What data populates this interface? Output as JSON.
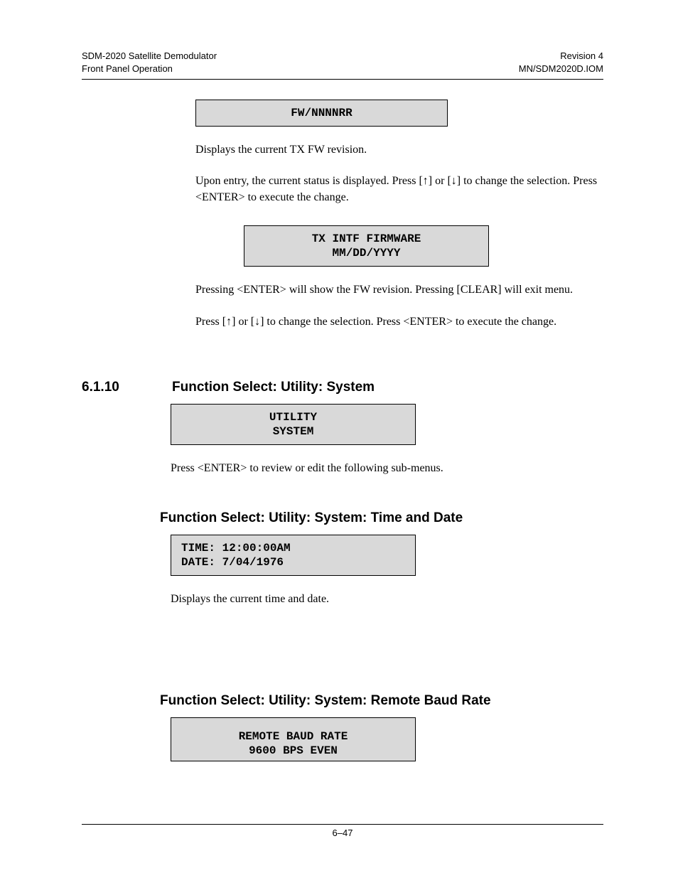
{
  "header": {
    "left_line1": "SDM-2020 Satellite Demodulator",
    "left_line2": "Front Panel Operation",
    "right_line1": "Revision 4",
    "right_line2": "MN/SDM2020D.IOM"
  },
  "box1": {
    "line1": "FW/NNNNRR"
  },
  "para1": "Displays the current TX FW revision.",
  "para2_pre": "Upon entry, the current status is displayed. Press [",
  "arrow_up": "↑",
  "para2_mid1": "] or [",
  "arrow_down": "↓",
  "para2_mid2": "] to change the selection. Press <ENTER> to execute the change.",
  "box2": {
    "line1": "TX INTF FIRMWARE",
    "line2": "MM/DD/YYYY"
  },
  "para3": "Pressing <ENTER> will show the FW revision. Pressing [CLEAR] will exit menu.",
  "para4_pre": "Press [",
  "para4_mid2": "] to change the selection. Press <ENTER> to execute the change.",
  "section": {
    "num": "6.1.10",
    "title": "Function Select: Utility: System"
  },
  "box3": {
    "line1": "UTILITY",
    "line2": "SYSTEM"
  },
  "para5": "Press <ENTER> to review or edit the following sub-menus.",
  "sub1": "Function Select: Utility: System: Time and Date",
  "box4": {
    "line1": "TIME: 12:00:00AM",
    "line2": "DATE: 7/04/1976"
  },
  "para6": "Displays the current time and date.",
  "sub2": "Function Select: Utility: System: Remote Baud Rate",
  "box5": {
    "line1": "REMOTE BAUD RATE",
    "line2": "9600 BPS  EVEN"
  },
  "footer": "6–47"
}
